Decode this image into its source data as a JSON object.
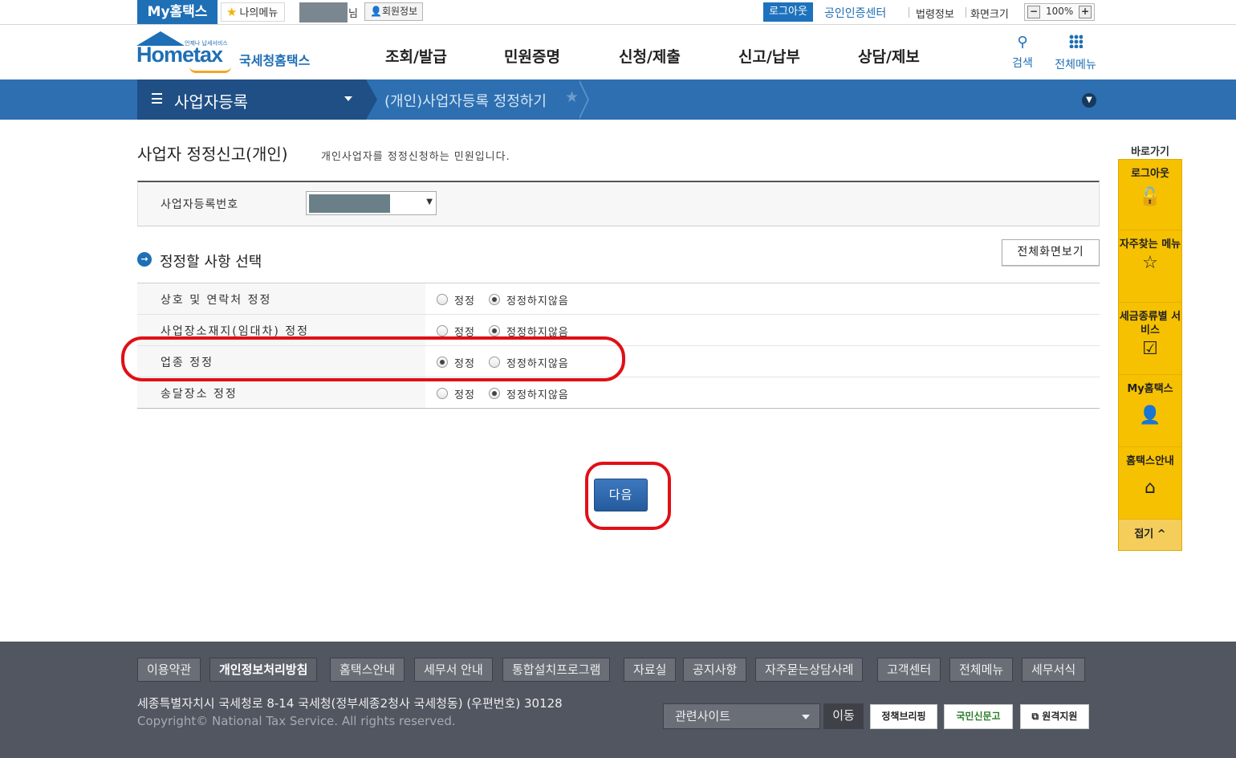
{
  "topbar": {
    "my_hometax": "My홈택스",
    "my_menu": "나의메뉴",
    "user_suffix": "님",
    "member_info": "회원정보",
    "logout": "로그아웃",
    "cert_center": "공인인증센터",
    "law_info": "법령정보",
    "screen_size": "화면크기",
    "zoom": "100%"
  },
  "header": {
    "logo_brand": "Hometax",
    "logo_kr": "국세청홈택스",
    "logo_tagline": "언제나 납세서비스",
    "nav": [
      "조회/발급",
      "민원증명",
      "신청/제출",
      "신고/납부",
      "상담/제보"
    ],
    "search_label": "검색",
    "allmenu_label": "전체메뉴"
  },
  "location": {
    "section": "사업자등록",
    "current": "(개인)사업자등록 정정하기"
  },
  "page": {
    "title": "사업자 정정신고(개인)",
    "description": "개인사업자를 정정신청하는 민원입니다.",
    "biz_number_label": "사업자등록번호",
    "section_title": "정정할 사항 선택",
    "fullview_button": "전체화면보기",
    "options": [
      {
        "label": "상호 및 연락처 정정",
        "opt1": "정정",
        "opt2": "정정하지않음",
        "selected": 2
      },
      {
        "label": "사업장소재지(임대차) 정정",
        "opt1": "정정",
        "opt2": "정정하지않음",
        "selected": 2
      },
      {
        "label": "업종 정정",
        "opt1": "정정",
        "opt2": "정정하지않음",
        "selected": 1
      },
      {
        "label": "송달장소 정정",
        "opt1": "정정",
        "opt2": "정정하지않음",
        "selected": 2
      }
    ],
    "next_button": "다음"
  },
  "quick": {
    "title": "바로가기",
    "items": [
      {
        "label": "로그아웃",
        "icon": "unlock-icon"
      },
      {
        "label": "자주찾는 메뉴",
        "icon": "star-icon"
      },
      {
        "label": "세금종류별 서비스",
        "icon": "checkbox-icon"
      },
      {
        "label": "My홈택스",
        "icon": "user-icon"
      },
      {
        "label": "홈택스안내",
        "icon": "house-icon"
      }
    ],
    "fold": "접기 ^"
  },
  "footer": {
    "links": [
      "이용약관",
      "개인정보처리방침",
      "홈택스안내",
      "세무서 안내",
      "통합설치프로그램",
      "자료실",
      "공지사항",
      "자주묻는상담사례",
      "고객센터",
      "전체메뉴",
      "세무서식"
    ],
    "address": "세종특별자치시 국세청로 8-14 국세청(정부세종2청사 국세청동) (우편번호) 30128",
    "copyright": "Copyright© National Tax Service. All rights reserved.",
    "related_sites": "관련사이트",
    "move": "이동",
    "banners": [
      "정책브리핑",
      "국민신문고",
      "원격지원"
    ]
  },
  "colors": {
    "brand_blue": "#1e6fb5",
    "loc_bar": "#2d6fb0",
    "highlight_red": "#e01016",
    "quick_yellow": "#f6c100",
    "footer_bg": "#525660"
  }
}
